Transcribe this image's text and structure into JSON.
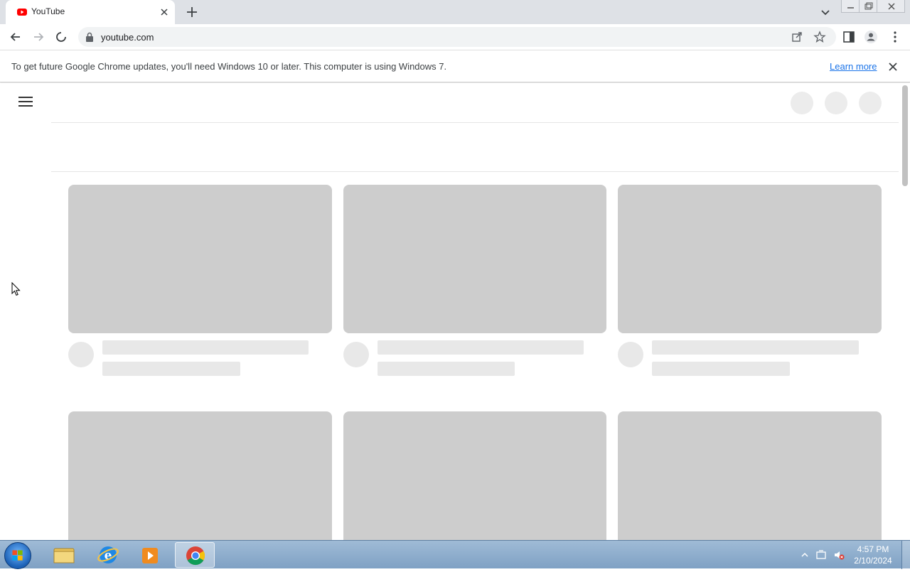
{
  "browser": {
    "tab": {
      "title": "YouTube",
      "favicon": "youtube-icon"
    },
    "url": "youtube.com",
    "colors": {
      "tab_strip": "#dee1e6",
      "omnibox": "#f1f3f4",
      "link": "#1a73e8"
    }
  },
  "infobar": {
    "message": "To get future Google Chrome updates, you'll need Windows 10 or later. This computer is using Windows 7.",
    "link_label": "Learn more"
  },
  "youtube": {
    "state": "loading",
    "skeleton_color": "#cdcdcd"
  },
  "taskbar": {
    "apps": [
      "windows-explorer-icon",
      "internet-explorer-icon",
      "media-player-icon",
      "chrome-icon"
    ],
    "clock": {
      "time": "4:57 PM",
      "date": "2/10/2024"
    }
  }
}
